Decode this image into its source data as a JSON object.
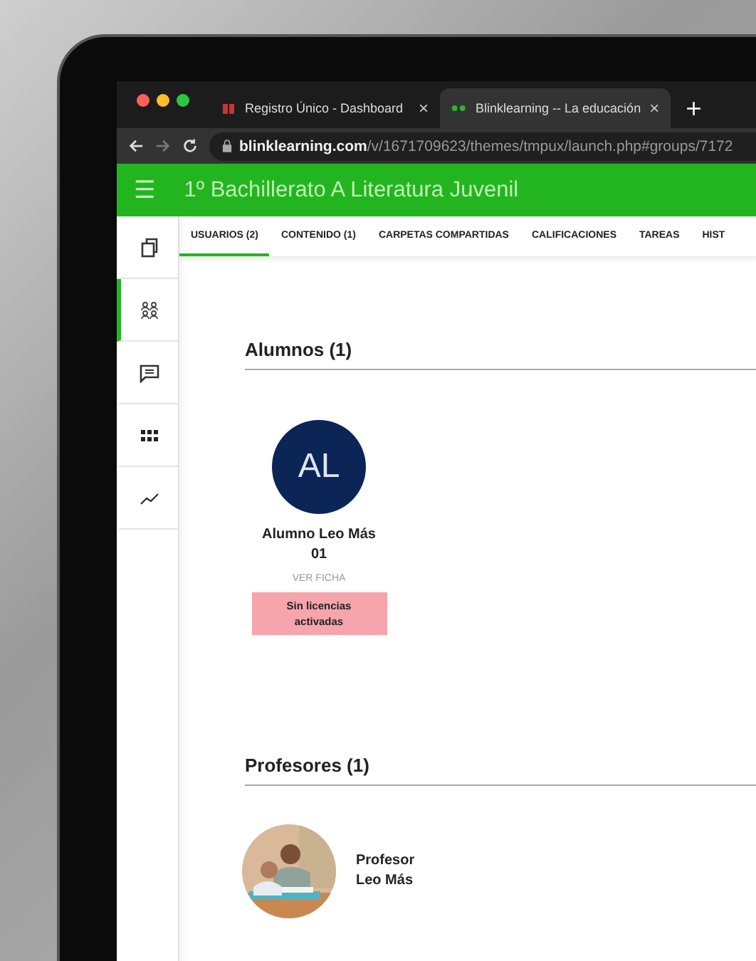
{
  "browser": {
    "tabs": [
      {
        "title": "Registro Único - Dashboard",
        "close": "×",
        "selected": false
      },
      {
        "title": "Blinklearning -- La educación",
        "close": "×",
        "selected": true
      }
    ],
    "new_tab": "+",
    "url_host": "blinklearning.com",
    "url_path": "/v/1671709623/themes/tmpux/launch.php#groups/7172"
  },
  "header": {
    "menu": "☰",
    "title": "1º Bachillerato A Literatura Juvenil"
  },
  "nav_tabs": [
    {
      "label": "USUARIOS (2)",
      "selected": true
    },
    {
      "label": "CONTENIDO (1)",
      "selected": false
    },
    {
      "label": "CARPETAS COMPARTIDAS",
      "selected": false
    },
    {
      "label": "CALIFICACIONES",
      "selected": false
    },
    {
      "label": "TAREAS",
      "selected": false
    },
    {
      "label": "HIST",
      "selected": false
    }
  ],
  "sidebar": {
    "items": [
      {
        "selected": false
      },
      {
        "selected": true
      },
      {
        "selected": false
      },
      {
        "selected": false
      },
      {
        "selected": false
      }
    ]
  },
  "students": {
    "title": "Alumnos (1)",
    "items": [
      {
        "initials": "AL",
        "name": "Alumno Leo Más 01",
        "link": "VER FICHA",
        "badge": "Sin licencias activadas"
      }
    ]
  },
  "teachers": {
    "title": "Profesores (1)",
    "items": [
      {
        "name": "Profesor Leo Más"
      }
    ]
  }
}
